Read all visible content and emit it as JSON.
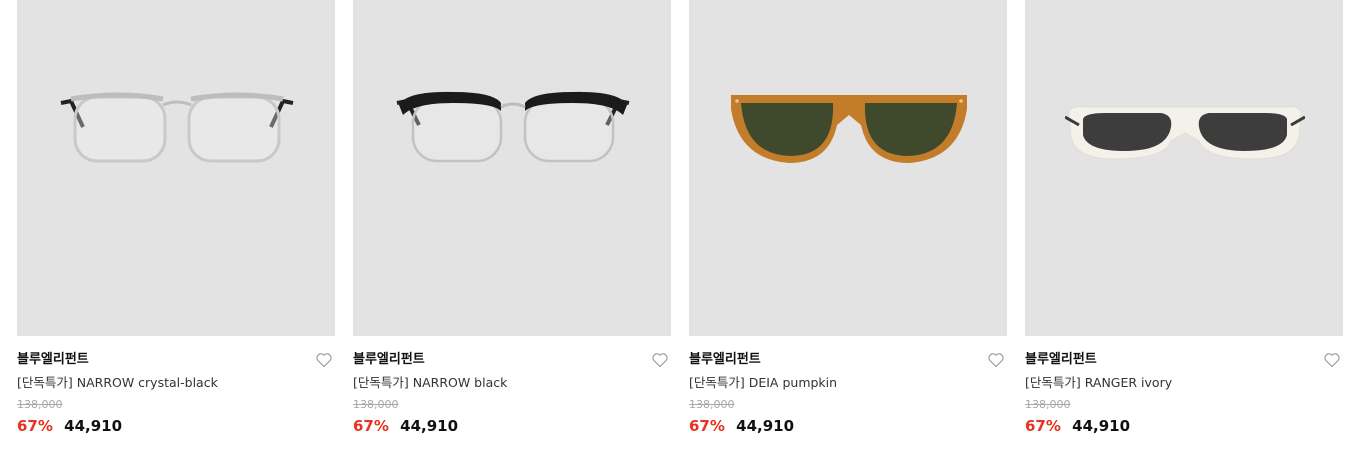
{
  "products": [
    {
      "image_icon": "crystal-black-glasses-icon",
      "brand": "블루엘리펀트",
      "name": "[단독특가] NARROW crystal-black",
      "original_price": "138,000",
      "discount": "67%",
      "price": "44,910"
    },
    {
      "image_icon": "black-browline-glasses-icon",
      "brand": "블루엘리펀트",
      "name": "[단독특가] NARROW black",
      "original_price": "138,000",
      "discount": "67%",
      "price": "44,910"
    },
    {
      "image_icon": "pumpkin-sunglasses-icon",
      "brand": "블루엘리펀트",
      "name": "[단독특가] DEIA pumpkin",
      "original_price": "138,000",
      "discount": "67%",
      "price": "44,910"
    },
    {
      "image_icon": "ivory-sunglasses-icon",
      "brand": "블루엘리펀트",
      "name": "[단독특가] RANGER ivory",
      "original_price": "138,000",
      "discount": "67%",
      "price": "44,910"
    }
  ],
  "colors": {
    "thumb_bg": "#e3e3e3",
    "discount": "#e8321e",
    "strike": "#a8a8a8"
  }
}
